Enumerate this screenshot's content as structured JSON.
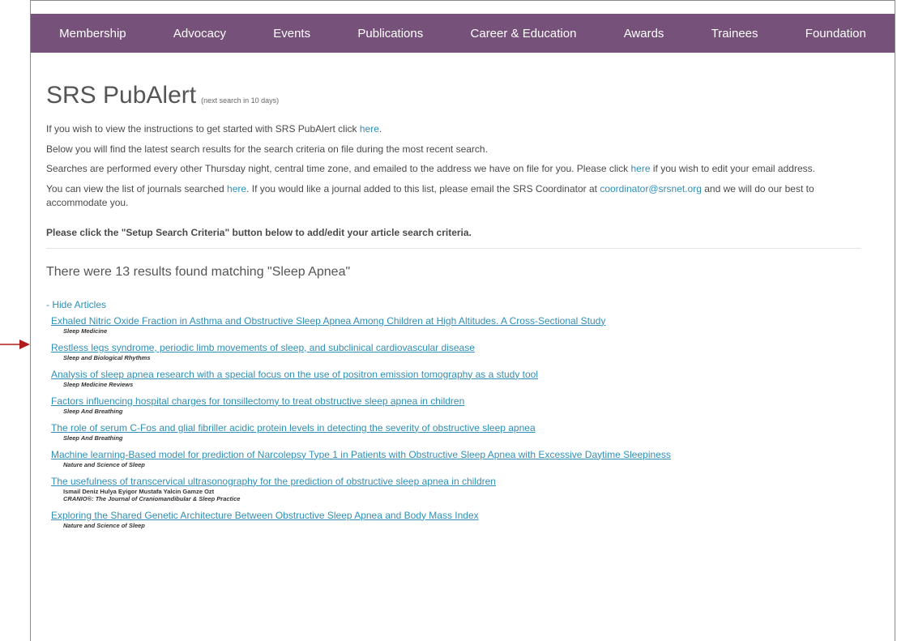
{
  "nav": {
    "items": [
      "Membership",
      "Advocacy",
      "Events",
      "Publications",
      "Career & Education",
      "Awards",
      "Trainees",
      "Foundation"
    ]
  },
  "page": {
    "title": "SRS PubAlert",
    "title_note": "(next search in 10 days)"
  },
  "info": {
    "p1_text": "If you wish to view the instructions to get started with SRS PubAlert click ",
    "p1_link": "here",
    "p1_end": ".",
    "p2_text": "Below you will find the latest search results for the search criteria on file during the most recent search.",
    "p3_text": "Searches are performed every other Thursday night, central time zone, and emailed to the address we have on file for you. Please click ",
    "p3_link": "here",
    "p3_end": " if you wish to edit your email address.",
    "p4_text": "You can view the list of journals searched ",
    "p4_link": "here",
    "p4_mid": ". If you would like a journal added to this list, please email the SRS Coordinator at ",
    "p4_email": "coordinator@srsnet.org",
    "p4_end": " and we will do our best to accommodate you.",
    "setup_note": "Please click the \"Setup Search Criteria\" button below to add/edit your article search criteria."
  },
  "results": {
    "heading": "There were 13 results found matching \"Sleep Apnea\"",
    "toggle_label": "- Hide Articles",
    "articles": [
      {
        "title": "Exhaled Nitric Oxide Fraction in Asthma and Obstructive Sleep Apnea Among Children at High Altitudes. A Cross-Sectional Study",
        "authors": "",
        "journal": "Sleep Medicine"
      },
      {
        "title": "Restless legs syndrome, periodic limb movements of sleep, and subclinical cardiovascular disease",
        "authors": "",
        "journal": "Sleep and Biological Rhythms"
      },
      {
        "title": "Analysis of sleep apnea research with a special focus on the use of positron emission tomography as a study tool",
        "authors": "",
        "journal": "Sleep Medicine Reviews"
      },
      {
        "title": "Factors influencing hospital charges for tonsillectomy to treat obstructive sleep apnea in children",
        "authors": "",
        "journal": "Sleep And Breathing"
      },
      {
        "title": "The role of serum C-Fos and glial fibriller acidic protein levels in detecting the severity of obstructive sleep apnea",
        "authors": "",
        "journal": "Sleep And Breathing"
      },
      {
        "title": "Machine learning-Based model for prediction of Narcolepsy Type 1 in Patients with Obstructive Sleep Apnea with Excessive Daytime Sleepiness",
        "authors": "",
        "journal": "Nature and Science of Sleep"
      },
      {
        "title": "The usefulness of transcervical ultrasonography for the prediction of obstructive sleep apnea in children",
        "authors": "Ismail Deniz Hulya Eyigor Mustafa Yalcin Gamze Ozt",
        "journal": "CRANIO®: The Journal of Craniomandibular & Sleep Practice"
      },
      {
        "title": "Exploring the Shared Genetic Architecture Between Obstructive Sleep Apnea and Body Mass Index",
        "authors": "",
        "journal": "Nature and Science of Sleep"
      }
    ]
  },
  "colors": {
    "nav_bg": "#76527a",
    "link": "#2f8fb6",
    "arrow": "#b01c1c"
  }
}
